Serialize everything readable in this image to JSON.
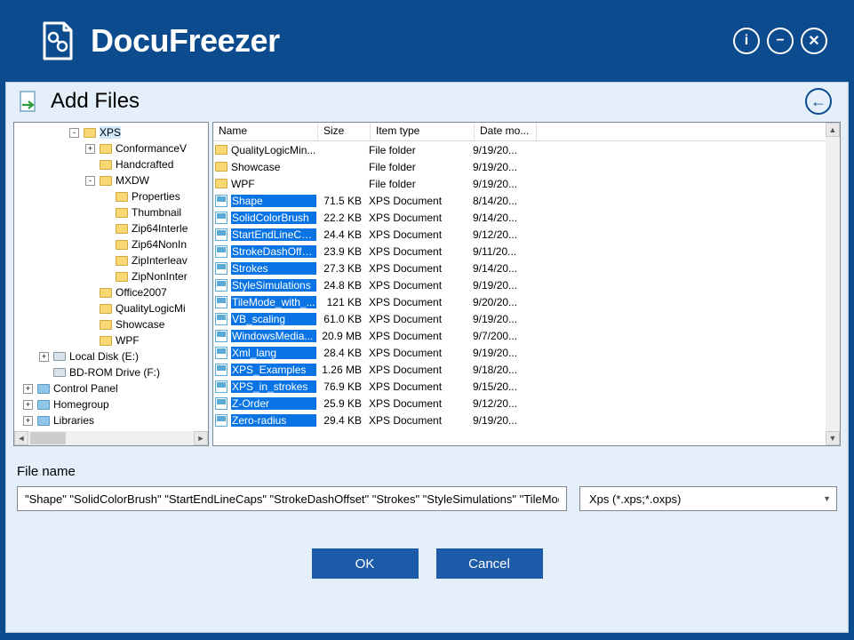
{
  "app": {
    "brand": "DocuFreezer"
  },
  "header": {
    "title": "Add Files"
  },
  "tree": [
    {
      "indent": 62,
      "toggle": "-",
      "icon": "folder",
      "label": "XPS",
      "sel": true
    },
    {
      "indent": 80,
      "toggle": "+",
      "icon": "folder",
      "label": "ConformanceV"
    },
    {
      "indent": 80,
      "toggle": " ",
      "icon": "folder",
      "label": "Handcrafted"
    },
    {
      "indent": 80,
      "toggle": "-",
      "icon": "folder",
      "label": "MXDW"
    },
    {
      "indent": 98,
      "toggle": " ",
      "icon": "folder",
      "label": "Properties"
    },
    {
      "indent": 98,
      "toggle": " ",
      "icon": "folder",
      "label": "Thumbnail"
    },
    {
      "indent": 98,
      "toggle": " ",
      "icon": "folder",
      "label": "Zip64Interle"
    },
    {
      "indent": 98,
      "toggle": " ",
      "icon": "folder",
      "label": "Zip64NonIn"
    },
    {
      "indent": 98,
      "toggle": " ",
      "icon": "folder",
      "label": "ZipInterleav"
    },
    {
      "indent": 98,
      "toggle": " ",
      "icon": "folder",
      "label": "ZipNonInter"
    },
    {
      "indent": 80,
      "toggle": " ",
      "icon": "folder",
      "label": "Office2007"
    },
    {
      "indent": 80,
      "toggle": " ",
      "icon": "folder",
      "label": "QualityLogicMi"
    },
    {
      "indent": 80,
      "toggle": " ",
      "icon": "folder",
      "label": "Showcase"
    },
    {
      "indent": 80,
      "toggle": " ",
      "icon": "folder",
      "label": "WPF"
    },
    {
      "indent": 28,
      "toggle": "+",
      "icon": "drive",
      "label": "Local Disk (E:)"
    },
    {
      "indent": 28,
      "toggle": " ",
      "icon": "drive",
      "label": "BD-ROM Drive (F:)"
    },
    {
      "indent": 10,
      "toggle": "+",
      "icon": "sys",
      "label": "Control Panel"
    },
    {
      "indent": 10,
      "toggle": "+",
      "icon": "sys",
      "label": "Homegroup"
    },
    {
      "indent": 10,
      "toggle": "+",
      "icon": "sys",
      "label": "Libraries"
    }
  ],
  "columns": {
    "name": "Name",
    "size": "Size",
    "type": "Item type",
    "date": "Date mo..."
  },
  "files": [
    {
      "icon": "folder",
      "name": "QualityLogicMin...",
      "sel": false,
      "size": "",
      "type": "File folder",
      "date": "9/19/20..."
    },
    {
      "icon": "folder",
      "name": "Showcase",
      "sel": false,
      "size": "",
      "type": "File folder",
      "date": "9/19/20..."
    },
    {
      "icon": "folder",
      "name": "WPF",
      "sel": false,
      "size": "",
      "type": "File folder",
      "date": "9/19/20..."
    },
    {
      "icon": "xps",
      "name": "Shape",
      "sel": true,
      "size": "71.5 KB",
      "type": "XPS Document",
      "date": "8/14/20..."
    },
    {
      "icon": "xps",
      "name": "SolidColorBrush",
      "sel": true,
      "size": "22.2 KB",
      "type": "XPS Document",
      "date": "9/14/20..."
    },
    {
      "icon": "xps",
      "name": "StartEndLineCa...",
      "sel": true,
      "size": "24.4 KB",
      "type": "XPS Document",
      "date": "9/12/20..."
    },
    {
      "icon": "xps",
      "name": "StrokeDashOffs...",
      "sel": true,
      "size": "23.9 KB",
      "type": "XPS Document",
      "date": "9/11/20..."
    },
    {
      "icon": "xps",
      "name": "Strokes",
      "sel": true,
      "size": "27.3 KB",
      "type": "XPS Document",
      "date": "9/14/20..."
    },
    {
      "icon": "xps",
      "name": "StyleSimulations",
      "sel": true,
      "size": "24.8 KB",
      "type": "XPS Document",
      "date": "9/19/20..."
    },
    {
      "icon": "xps",
      "name": "TileMode_with_...",
      "sel": true,
      "size": "121 KB",
      "type": "XPS Document",
      "date": "9/20/20..."
    },
    {
      "icon": "xps",
      "name": "VB_scaling",
      "sel": true,
      "size": "61.0 KB",
      "type": "XPS Document",
      "date": "9/19/20..."
    },
    {
      "icon": "xps",
      "name": "WindowsMedia...",
      "sel": true,
      "size": "20.9 MB",
      "type": "XPS Document",
      "date": "9/7/200..."
    },
    {
      "icon": "xps",
      "name": "Xml_lang",
      "sel": true,
      "size": "28.4 KB",
      "type": "XPS Document",
      "date": "9/19/20..."
    },
    {
      "icon": "xps",
      "name": "XPS_Examples",
      "sel": true,
      "size": "1.26 MB",
      "type": "XPS Document",
      "date": "9/18/20..."
    },
    {
      "icon": "xps",
      "name": "XPS_in_strokes",
      "sel": true,
      "size": "76.9 KB",
      "type": "XPS Document",
      "date": "9/15/20..."
    },
    {
      "icon": "xps",
      "name": "Z-Order",
      "sel": true,
      "size": "25.9 KB",
      "type": "XPS Document",
      "date": "9/12/20..."
    },
    {
      "icon": "xps",
      "name": "Zero-radius",
      "sel": true,
      "size": "29.4 KB",
      "type": "XPS Document",
      "date": "9/19/20..."
    }
  ],
  "filebox": {
    "label": "File name",
    "value": "\"Shape\" \"SolidColorBrush\" \"StartEndLineCaps\" \"StrokeDashOffset\" \"Strokes\" \"StyleSimulations\" \"TileMode_with_Viewport\" \"VB_scaling\" \"WindowsMedia\" \"Xml_lang\" \"XPS_Examples\" \"XPS_in_strokes\" \"Z-Order\" \"Zero-radius\"",
    "filter": "Xps (*.xps;*.oxps)"
  },
  "buttons": {
    "ok": "OK",
    "cancel": "Cancel"
  }
}
